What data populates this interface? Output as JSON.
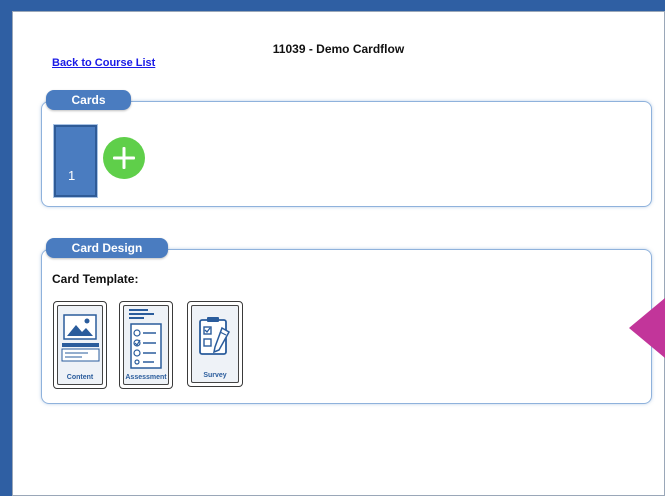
{
  "page": {
    "title": "11039 - Demo Cardflow",
    "back_link": "Back to Course List"
  },
  "cards_panel": {
    "tab_label": "Cards",
    "cards": [
      {
        "number": "1"
      }
    ],
    "add_icon": "plus-icon"
  },
  "design_panel": {
    "tab_label": "Card Design",
    "template_label": "Card Template:",
    "templates": [
      {
        "name": "Content",
        "icon": "image-layout-icon"
      },
      {
        "name": "Assessment",
        "icon": "checklist-icon"
      },
      {
        "name": "Survey",
        "icon": "clipboard-pencil-icon"
      }
    ]
  },
  "colors": {
    "frame_blue": "#2f5fa3",
    "tab_blue": "#4a7cc0",
    "add_green": "#5fcf4a",
    "marker_magenta": "#c2359a",
    "link_blue": "#1a1ae6"
  }
}
